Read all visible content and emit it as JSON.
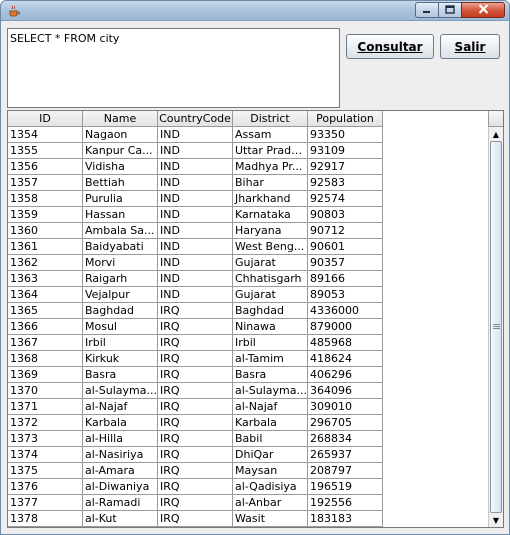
{
  "window": {
    "query_text": "SELECT * FROM city",
    "buttons": {
      "consultar": "Consultar",
      "salir": "Salir"
    }
  },
  "table": {
    "columns": [
      "ID",
      "Name",
      "CountryCode",
      "District",
      "Population"
    ],
    "rows": [
      [
        "1354",
        "Nagaon",
        "IND",
        "Assam",
        "93350"
      ],
      [
        "1355",
        "Kanpur Ca...",
        "IND",
        "Uttar Prade...",
        "93109"
      ],
      [
        "1356",
        "Vidisha",
        "IND",
        "Madhya Pr...",
        "92917"
      ],
      [
        "1357",
        "Bettiah",
        "IND",
        "Bihar",
        "92583"
      ],
      [
        "1358",
        "Purulia",
        "IND",
        "Jharkhand",
        "92574"
      ],
      [
        "1359",
        "Hassan",
        "IND",
        "Karnataka",
        "90803"
      ],
      [
        "1360",
        "Ambala Sa...",
        "IND",
        "Haryana",
        "90712"
      ],
      [
        "1361",
        "Baidyabati",
        "IND",
        "West Beng...",
        "90601"
      ],
      [
        "1362",
        "Morvi",
        "IND",
        "Gujarat",
        "90357"
      ],
      [
        "1363",
        "Raigarh",
        "IND",
        "Chhatisgarh",
        "89166"
      ],
      [
        "1364",
        "Vejalpur",
        "IND",
        "Gujarat",
        "89053"
      ],
      [
        "1365",
        "Baghdad",
        "IRQ",
        "Baghdad",
        "4336000"
      ],
      [
        "1366",
        "Mosul",
        "IRQ",
        "Ninawa",
        "879000"
      ],
      [
        "1367",
        "Irbil",
        "IRQ",
        "Irbil",
        "485968"
      ],
      [
        "1368",
        "Kirkuk",
        "IRQ",
        "al-Tamim",
        "418624"
      ],
      [
        "1369",
        "Basra",
        "IRQ",
        "Basra",
        "406296"
      ],
      [
        "1370",
        "al-Sulayma...",
        "IRQ",
        "al-Sulayma...",
        "364096"
      ],
      [
        "1371",
        "al-Najaf",
        "IRQ",
        "al-Najaf",
        "309010"
      ],
      [
        "1372",
        "Karbala",
        "IRQ",
        "Karbala",
        "296705"
      ],
      [
        "1373",
        "al-Hilla",
        "IRQ",
        "Babil",
        "268834"
      ],
      [
        "1374",
        "al-Nasiriya",
        "IRQ",
        "DhiQar",
        "265937"
      ],
      [
        "1375",
        "al-Amara",
        "IRQ",
        "Maysan",
        "208797"
      ],
      [
        "1376",
        "al-Diwaniya",
        "IRQ",
        "al-Qadisiya",
        "196519"
      ],
      [
        "1377",
        "al-Ramadi",
        "IRQ",
        "al-Anbar",
        "192556"
      ],
      [
        "1378",
        "al-Kut",
        "IRQ",
        "Wasit",
        "183183"
      ]
    ]
  },
  "icons": {
    "app": "java-coffee-icon",
    "minimize": "minimize-icon",
    "maximize": "maximize-icon",
    "close": "close-icon"
  },
  "colors": {
    "titlebar": "#a9c2dc",
    "close_button": "#d4593e",
    "window_bg": "#eeeeee"
  },
  "scrollbar": {
    "position_fraction": 0.5
  }
}
